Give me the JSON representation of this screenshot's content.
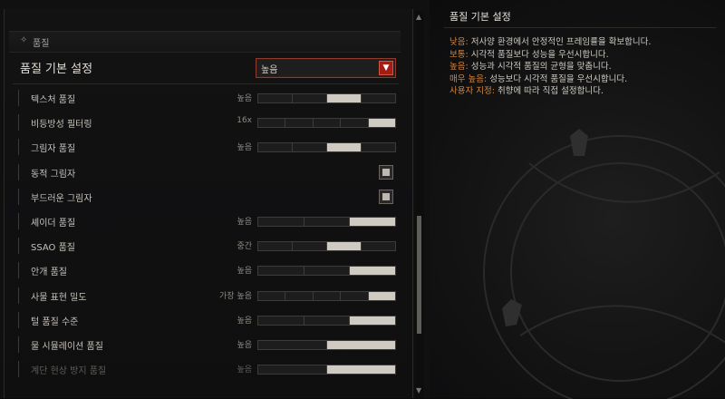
{
  "section": {
    "icon": "diamond-sparkle-icon",
    "title": "품질"
  },
  "preset": {
    "label": "품질 기본 설정",
    "value": "높음"
  },
  "settings": [
    {
      "name": "텍스처 품질",
      "value": "높음",
      "type": "slider",
      "segments": 4,
      "active": 3,
      "position": 0.75
    },
    {
      "name": "비등방성 필터링",
      "value": "16x",
      "type": "slider",
      "segments": 5,
      "active": 5,
      "position": 1.0
    },
    {
      "name": "그림자 품질",
      "value": "높음",
      "type": "slider",
      "segments": 4,
      "active": 3,
      "position": 0.75
    },
    {
      "name": "동적 그림자",
      "type": "checkbox",
      "checked": true
    },
    {
      "name": "부드러운 그림자",
      "type": "checkbox",
      "checked": true
    },
    {
      "name": "셰이더 품질",
      "value": "높음",
      "type": "slider",
      "segments": 3,
      "active": 3,
      "position": 1.0
    },
    {
      "name": "SSAO 품질",
      "value": "중간",
      "type": "slider",
      "segments": 4,
      "active": 3,
      "position": 0.75
    },
    {
      "name": "안개 품질",
      "value": "높음",
      "type": "slider",
      "segments": 3,
      "active": 3,
      "position": 1.0
    },
    {
      "name": "사물 표현 밀도",
      "value": "가장 높음",
      "type": "slider",
      "segments": 5,
      "active": 5,
      "position": 1.0
    },
    {
      "name": "털 품질 수준",
      "value": "높음",
      "type": "slider",
      "segments": 3,
      "active": 3,
      "position": 1.0
    },
    {
      "name": "물 시뮬레이션 품질",
      "value": "높음",
      "type": "slider",
      "segments": 2,
      "active": 2,
      "position": 1.0
    },
    {
      "name": "계단 현상 방지 품질",
      "value": "높음",
      "type": "slider",
      "segments": 2,
      "active": 2,
      "position": 1.0,
      "dim": true
    }
  ],
  "tooltip": {
    "title": "품질 기본 설정",
    "lines": [
      {
        "key": "낮음:",
        "text": " 저사양 환경에서 안정적인 프레임률을 확보합니다."
      },
      {
        "key": "보통:",
        "text": " 시각적 품질보다 성능을 우선시합니다."
      },
      {
        "key": "높음:",
        "text": " 성능과 시각적 품질의 균형을 맞춥니다."
      },
      {
        "key": "매우 높음:",
        "text": " 성능보다 시각적 품질을 우선시합니다."
      },
      {
        "key": "사용자 지정:",
        "text": " 취향에 따라 직접 설정합니다."
      }
    ]
  },
  "scrollbar": {
    "up_icon": "scroll-up-arrow-icon",
    "down_icon": "scroll-down-arrow-icon"
  },
  "colors": {
    "accent": "#d7863b",
    "dropdown_border": "#8e3b2c",
    "dropdown_arrow": "#a31d14"
  }
}
